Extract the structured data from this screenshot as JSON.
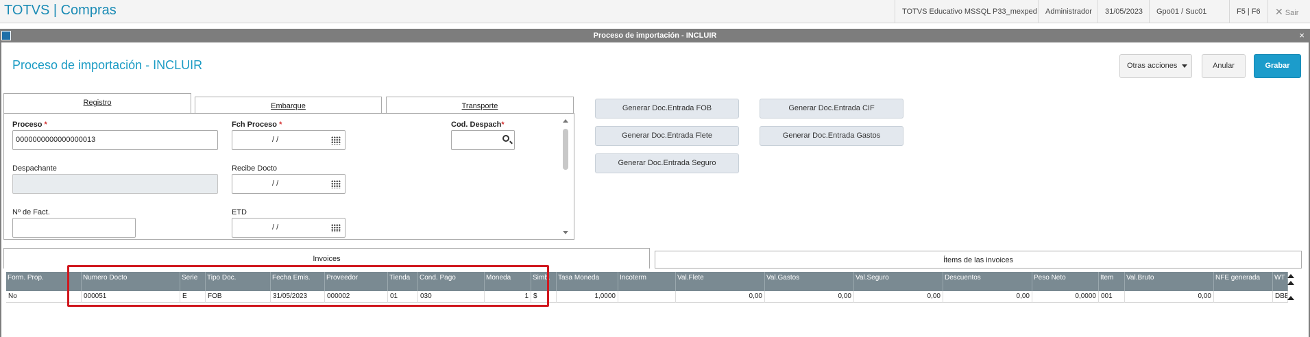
{
  "app": {
    "title": "TOTVS | Compras",
    "environment": "TOTVS Educativo MSSQL P33_mexped",
    "user": "Administrador",
    "date": "31/05/2023",
    "branch": "Gpo01 / Suc01",
    "shortcuts": "F5 | F6",
    "exit_label": "Sair"
  },
  "dialog": {
    "title": "Proceso de importación - INCLUIR",
    "close_symbol": "×"
  },
  "page": {
    "title": "Proceso de importación - INCLUIR"
  },
  "actions": {
    "other_label": "Otras acciones",
    "cancel_label": "Anular",
    "save_label": "Grabar"
  },
  "tabs": [
    {
      "label": "Registro"
    },
    {
      "label": "Embarque"
    },
    {
      "label": "Transporte"
    }
  ],
  "form": {
    "proceso": {
      "label": "Proceso",
      "value": "0000000000000000013"
    },
    "fch_proceso": {
      "label": "Fch Proceso",
      "value": "/ /"
    },
    "cod_despach": {
      "label": "Cod. Despach",
      "value": ""
    },
    "despachante": {
      "label": "Despachante",
      "value": ""
    },
    "recibe_docto": {
      "label": "Recibe Docto",
      "value": "/ /"
    },
    "nro_fact": {
      "label": "Nº de Fact.",
      "value": ""
    },
    "etd": {
      "label": "ETD",
      "value": "/ /"
    },
    "required_mark": "*"
  },
  "generate_buttons": {
    "fob": "Generar Doc.Entrada FOB",
    "cif": "Generar Doc.Entrada CIF",
    "flete": "Generar Doc.Entrada Flete",
    "gastos": "Generar Doc.Entrada Gastos",
    "seguro": "Generar Doc.Entrada Seguro"
  },
  "bottom_tabs": {
    "invoices": "Invoices",
    "items": "Ítems de las invoices"
  },
  "grid": {
    "headers": [
      "Form. Prop.",
      "Numero Docto",
      "Serie",
      "Tipo Doc.",
      "Fecha Emis.",
      "Proveedor",
      "Tienda",
      "Cond. Pago",
      "Moneda",
      "Simb.",
      "Tasa Moneda",
      "Incoterm",
      "Val.Flete",
      "Val.Gastos",
      "Val.Seguro",
      "Descuentos",
      "Peso Neto",
      "Item",
      "Val.Bruto",
      "NFE generada",
      "WT ab"
    ],
    "rows": [
      [
        "No",
        "000051",
        "E",
        "FOB",
        "31/05/2023",
        "000002",
        "01",
        "030",
        "1",
        "$",
        "1,0000",
        "",
        "0,00",
        "0,00",
        "0,00",
        "0,00",
        "0,0000",
        "001",
        "0,00",
        "",
        "DBB"
      ]
    ]
  }
}
